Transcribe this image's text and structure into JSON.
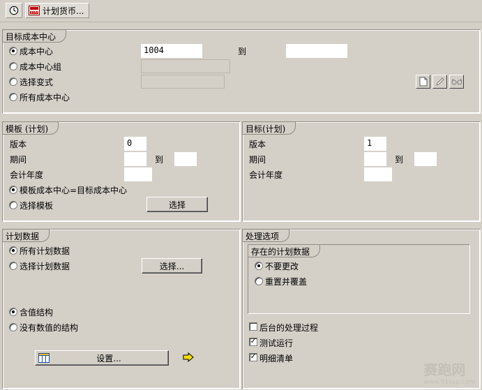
{
  "toolbar": {
    "plan_currency_button": "计划货币..."
  },
  "target_cost_center": {
    "title": "目标成本中心",
    "options": [
      "成本中心",
      "成本中心组",
      "选择变式",
      "所有成本中心"
    ],
    "cost_center_value": "1004",
    "to_label": "到"
  },
  "template_plan": {
    "title": "模板 (计划)",
    "version_label": "版本",
    "version_value": "0",
    "period_label": "期间",
    "to_label": "到",
    "fiscal_year_label": "会计年度",
    "option_template_eq_target": "模板成本中心=目标成本中心",
    "option_select_template": "选择模板",
    "select_button": "选择"
  },
  "target_plan": {
    "title": "目标(计划)",
    "version_label": "版本",
    "version_value": "1",
    "period_label": "期间",
    "to_label": "到",
    "fiscal_year_label": "会计年度"
  },
  "plan_data": {
    "title": "计划数据",
    "option_all": "所有计划数据",
    "option_select": "选择计划数据",
    "select_button": "选择...",
    "option_with_values": "含值结构",
    "option_without_values": "没有数值的结构",
    "settings_button": "设置..."
  },
  "processing_options": {
    "title": "处理选项",
    "existing_title": "存在的计划数据",
    "option_no_change": "不要更改",
    "option_reset_overwrite": "重置并覆盖",
    "background_label": "后台的处理过程",
    "test_run_label": "测试运行",
    "detail_list_label": "明细清单"
  },
  "watermark": {
    "text": "赛跑网",
    "url": "www.91sap.com"
  }
}
